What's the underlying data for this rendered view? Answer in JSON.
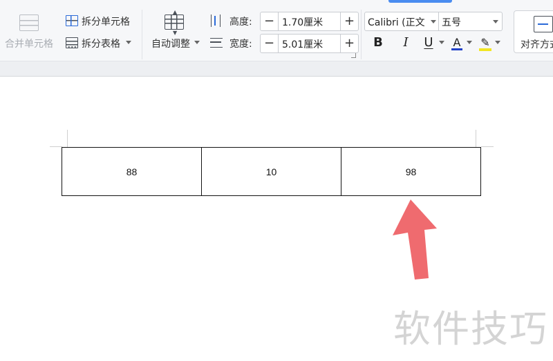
{
  "ribbon": {
    "merge_cells": "合并单元格",
    "split_cells": "拆分单元格",
    "split_table": "拆分表格",
    "autofit": "自动调整",
    "height_label": "高度:",
    "height_value": "1.70厘米",
    "width_label": "宽度:",
    "width_value": "5.01厘米",
    "minus_glyph": "−",
    "plus_glyph": "+",
    "font_name": "Calibri (正文",
    "font_size": "五号",
    "bold_glyph": "B",
    "italic_glyph": "I",
    "underline_glyph": "U",
    "font_color_glyph": "A",
    "highlight_glyph": "✎",
    "align_label": "对齐方式",
    "colors": {
      "font_color_bar": "#2040c8",
      "highlight_bar": "#f2e622",
      "accent": "#2a6ad8"
    }
  },
  "table": {
    "rows": [
      [
        "88",
        "10",
        "98"
      ]
    ]
  },
  "annotation": {
    "arrow_color": "#ef6b6f",
    "arrow_icon": "up-arrow-annotation"
  },
  "watermark": "软件技巧"
}
